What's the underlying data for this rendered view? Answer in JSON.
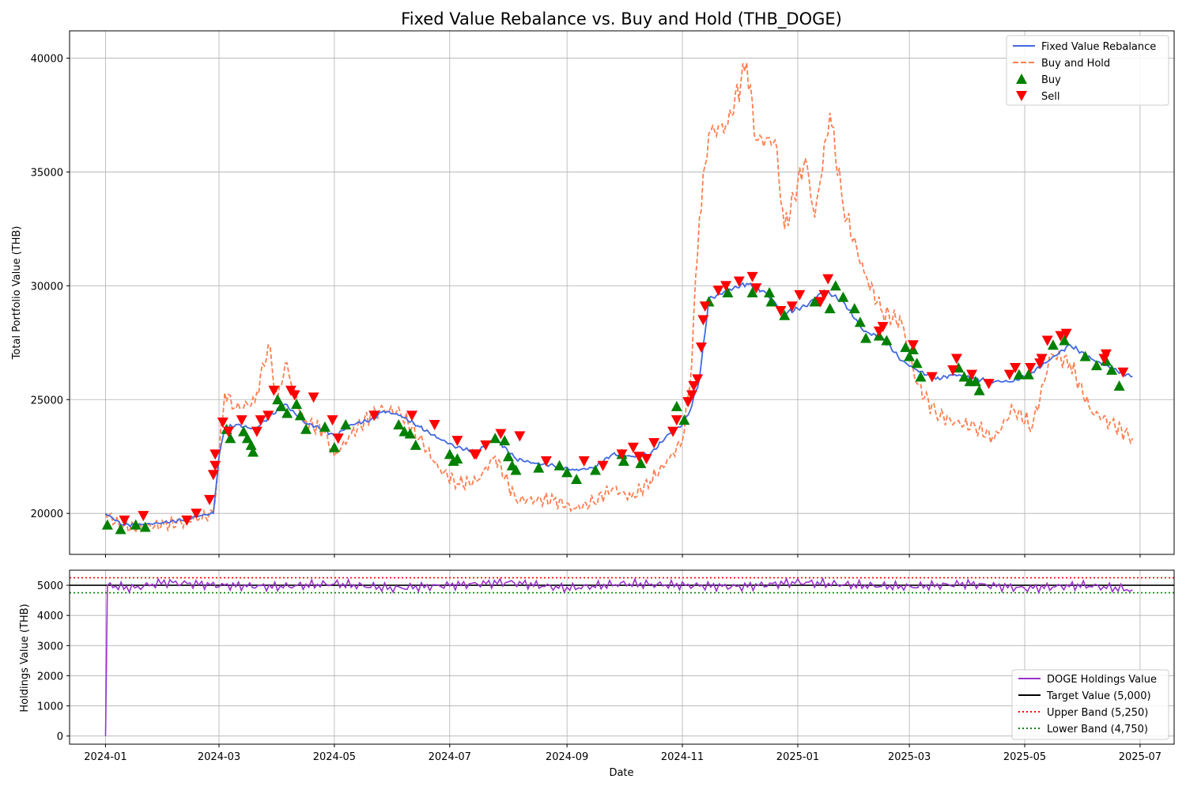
{
  "chart_data": [
    {
      "type": "line",
      "title": "Fixed Value Rebalance vs. Buy and Hold (THB_DOGE)",
      "xlabel": "",
      "ylabel": "Total Portfolio Value (THB)",
      "xlim": [
        "2023-12-13",
        "2025-07-19"
      ],
      "ylim": [
        18200,
        41200
      ],
      "x_ticks": [
        "2024-01-01",
        "2024-03-01",
        "2024-05-01",
        "2024-07-01",
        "2024-09-01",
        "2024-11-01",
        "2025-01-01",
        "2025-03-01",
        "2025-05-01",
        "2025-07-01"
      ],
      "x_tick_labels": [
        "2024-01",
        "2024-03",
        "2024-05",
        "2024-07",
        "2024-09",
        "2024-11",
        "2025-01",
        "2025-03",
        "2025-05",
        "2025-07"
      ],
      "y_ticks": [
        20000,
        25000,
        30000,
        35000,
        40000
      ],
      "grid": true,
      "legend_position": "top-right",
      "colors": {
        "rebalance": "#4169e1",
        "buy_hold": "#ff7f50",
        "buy": "#008000",
        "sell": "#ff0000"
      },
      "series": [
        {
          "name": "Fixed Value Rebalance",
          "style": "solid",
          "x": [
            "2024-01-01",
            "2024-01-10",
            "2024-01-20",
            "2024-02-01",
            "2024-02-10",
            "2024-02-20",
            "2024-02-27",
            "2024-03-01",
            "2024-03-04",
            "2024-03-10",
            "2024-03-20",
            "2024-03-27",
            "2024-04-05",
            "2024-04-15",
            "2024-04-25",
            "2024-05-01",
            "2024-05-10",
            "2024-05-20",
            "2024-05-27",
            "2024-06-05",
            "2024-06-15",
            "2024-06-25",
            "2024-07-05",
            "2024-07-15",
            "2024-07-25",
            "2024-08-05",
            "2024-08-15",
            "2024-08-25",
            "2024-09-05",
            "2024-09-15",
            "2024-09-25",
            "2024-10-05",
            "2024-10-15",
            "2024-10-25",
            "2024-11-01",
            "2024-11-05",
            "2024-11-10",
            "2024-11-15",
            "2024-11-25",
            "2024-12-05",
            "2024-12-15",
            "2024-12-25",
            "2025-01-05",
            "2025-01-15",
            "2025-01-25",
            "2025-02-05",
            "2025-02-15",
            "2025-02-25",
            "2025-03-05",
            "2025-03-15",
            "2025-03-25",
            "2025-04-05",
            "2025-04-15",
            "2025-04-25",
            "2025-05-05",
            "2025-05-15",
            "2025-05-25",
            "2025-06-05",
            "2025-06-15",
            "2025-06-27"
          ],
          "values": [
            20000,
            19500,
            19500,
            19600,
            19700,
            19900,
            20000,
            22500,
            23700,
            23900,
            23700,
            24200,
            24800,
            24000,
            23700,
            23400,
            23900,
            24100,
            24500,
            24300,
            23800,
            23300,
            22900,
            22700,
            23300,
            22400,
            22200,
            22100,
            21900,
            22000,
            22600,
            22500,
            22600,
            23500,
            23900,
            24500,
            25900,
            29400,
            29800,
            30100,
            29700,
            28800,
            29100,
            29800,
            29300,
            28000,
            27700,
            26700,
            26300,
            25900,
            26100,
            25900,
            25800,
            25800,
            26200,
            26800,
            27400,
            26800,
            26400,
            26000
          ]
        },
        {
          "name": "Buy and Hold",
          "style": "dashed",
          "x": [
            "2024-01-01",
            "2024-01-10",
            "2024-01-20",
            "2024-02-01",
            "2024-02-10",
            "2024-02-20",
            "2024-02-27",
            "2024-03-01",
            "2024-03-04",
            "2024-03-10",
            "2024-03-20",
            "2024-03-27",
            "2024-04-01",
            "2024-04-05",
            "2024-04-15",
            "2024-04-25",
            "2024-05-01",
            "2024-05-10",
            "2024-05-20",
            "2024-05-27",
            "2024-06-05",
            "2024-06-15",
            "2024-06-25",
            "2024-07-05",
            "2024-07-15",
            "2024-07-25",
            "2024-08-05",
            "2024-08-15",
            "2024-08-25",
            "2024-09-05",
            "2024-09-15",
            "2024-09-25",
            "2024-10-05",
            "2024-10-15",
            "2024-10-25",
            "2024-11-01",
            "2024-11-05",
            "2024-11-10",
            "2024-11-15",
            "2024-11-25",
            "2024-12-05",
            "2024-12-10",
            "2024-12-20",
            "2024-12-25",
            "2025-01-05",
            "2025-01-10",
            "2025-01-18",
            "2025-01-25",
            "2025-02-05",
            "2025-02-15",
            "2025-02-25",
            "2025-03-05",
            "2025-03-15",
            "2025-03-25",
            "2025-04-05",
            "2025-04-15",
            "2025-04-25",
            "2025-05-05",
            "2025-05-15",
            "2025-05-25",
            "2025-06-05",
            "2025-06-15",
            "2025-06-27"
          ],
          "values": [
            20000,
            19400,
            19400,
            19500,
            19600,
            19800,
            20000,
            22500,
            25300,
            24600,
            24900,
            27400,
            25000,
            26600,
            24000,
            23700,
            22500,
            23500,
            24300,
            24600,
            24400,
            23300,
            22000,
            21300,
            21400,
            22500,
            20600,
            20600,
            20600,
            20200,
            20500,
            21100,
            20700,
            21400,
            22400,
            23200,
            25600,
            33000,
            36700,
            37100,
            39800,
            36400,
            36400,
            32500,
            35600,
            33000,
            37600,
            33500,
            30600,
            28800,
            28400,
            25700,
            24400,
            24000,
            23800,
            23300,
            24600,
            23800,
            27000,
            26600,
            24500,
            24000,
            23300
          ]
        }
      ],
      "markers": {
        "buy": {
          "name": "Buy",
          "x": [
            "2024-01-02",
            "2024-01-09",
            "2024-01-17",
            "2024-01-22",
            "2024-03-05",
            "2024-03-07",
            "2024-03-14",
            "2024-03-16",
            "2024-03-18",
            "2024-03-19",
            "2024-04-01",
            "2024-04-03",
            "2024-04-06",
            "2024-04-11",
            "2024-04-13",
            "2024-04-16",
            "2024-04-26",
            "2024-05-01",
            "2024-05-07",
            "2024-06-04",
            "2024-06-07",
            "2024-06-10",
            "2024-06-13",
            "2024-07-01",
            "2024-07-03",
            "2024-07-05",
            "2024-07-25",
            "2024-07-30",
            "2024-08-01",
            "2024-08-03",
            "2024-08-05",
            "2024-08-17",
            "2024-08-28",
            "2024-09-01",
            "2024-09-06",
            "2024-09-16",
            "2024-09-30",
            "2024-10-01",
            "2024-10-10",
            "2024-10-29",
            "2024-11-02",
            "2024-11-15",
            "2024-11-25",
            "2024-12-08",
            "2024-12-17",
            "2024-12-18",
            "2024-12-25",
            "2025-01-10",
            "2025-01-18",
            "2025-01-21",
            "2025-01-25",
            "2025-01-31",
            "2025-02-03",
            "2025-02-06",
            "2025-02-13",
            "2025-02-17",
            "2025-02-27",
            "2025-03-01",
            "2025-03-03",
            "2025-03-05",
            "2025-03-07",
            "2025-03-27",
            "2025-03-30",
            "2025-04-02",
            "2025-04-05",
            "2025-04-07",
            "2025-04-28",
            "2025-05-03",
            "2025-05-16",
            "2025-05-22",
            "2025-06-02",
            "2025-06-08",
            "2025-06-13",
            "2025-06-16",
            "2025-06-20"
          ],
          "values": [
            19500,
            19300,
            19500,
            19400,
            23700,
            23300,
            23600,
            23300,
            23000,
            22700,
            25000,
            24700,
            24400,
            24800,
            24300,
            23700,
            23800,
            22900,
            23900,
            23900,
            23600,
            23500,
            23000,
            22600,
            22300,
            22400,
            23300,
            23200,
            22500,
            22100,
            21900,
            22000,
            22100,
            21800,
            21500,
            21900,
            22600,
            22300,
            22200,
            24700,
            24100,
            29300,
            29700,
            29700,
            29700,
            29300,
            28700,
            29300,
            29000,
            30000,
            29500,
            29000,
            28400,
            27700,
            27800,
            27600,
            27300,
            26900,
            27200,
            26600,
            26000,
            26400,
            26000,
            25800,
            25800,
            25400,
            26100,
            26100,
            27400,
            27600,
            26900,
            26500,
            26700,
            26300,
            25600
          ],
          "direction": "up"
        },
        "sell": {
          "name": "Sell",
          "x": [
            "2024-01-11",
            "2024-01-21",
            "2024-02-13",
            "2024-02-18",
            "2024-02-25",
            "2024-02-27",
            "2024-02-28",
            "2024-02-28",
            "2024-03-03",
            "2024-03-06",
            "2024-03-13",
            "2024-03-21",
            "2024-03-23",
            "2024-03-27",
            "2024-03-30",
            "2024-04-08",
            "2024-04-10",
            "2024-04-20",
            "2024-04-30",
            "2024-05-03",
            "2024-05-22",
            "2024-06-11",
            "2024-06-23",
            "2024-07-05",
            "2024-07-14",
            "2024-07-15",
            "2024-07-20",
            "2024-07-28",
            "2024-08-07",
            "2024-08-21",
            "2024-09-10",
            "2024-09-20",
            "2024-09-30",
            "2024-10-06",
            "2024-10-09",
            "2024-10-13",
            "2024-10-17",
            "2024-10-27",
            "2024-10-29",
            "2024-11-04",
            "2024-11-06",
            "2024-11-07",
            "2024-11-09",
            "2024-11-11",
            "2024-11-12",
            "2024-11-13",
            "2024-11-20",
            "2024-11-24",
            "2024-12-01",
            "2024-12-08",
            "2024-12-10",
            "2024-12-23",
            "2024-12-29",
            "2025-01-02",
            "2025-01-13",
            "2025-01-15",
            "2025-01-17",
            "2025-02-13",
            "2025-02-15",
            "2025-03-03",
            "2025-03-13",
            "2025-03-24",
            "2025-03-26",
            "2025-04-03",
            "2025-04-12",
            "2025-04-23",
            "2025-04-26",
            "2025-05-04",
            "2025-05-09",
            "2025-05-10",
            "2025-05-13",
            "2025-05-20",
            "2025-05-23",
            "2025-06-12",
            "2025-06-13",
            "2025-06-22"
          ],
          "values": [
            19700,
            19900,
            19700,
            20000,
            20600,
            21700,
            22100,
            22600,
            24000,
            23600,
            24100,
            23600,
            24100,
            24300,
            25400,
            25400,
            25200,
            25100,
            24100,
            23300,
            24300,
            24300,
            23900,
            23200,
            22600,
            22600,
            23000,
            23500,
            23400,
            22300,
            22300,
            22100,
            22600,
            22900,
            22500,
            22400,
            23100,
            23600,
            24100,
            24900,
            25200,
            25600,
            25900,
            27300,
            28500,
            29100,
            29800,
            30000,
            30200,
            30400,
            29900,
            28900,
            29100,
            29600,
            29300,
            29600,
            30300,
            28000,
            28200,
            27400,
            26000,
            26300,
            26800,
            26100,
            25700,
            26100,
            26400,
            26400,
            26600,
            26800,
            27600,
            27800,
            27900,
            26800,
            27000,
            26200
          ]
        }
      }
    },
    {
      "type": "line",
      "title": "",
      "xlabel": "Date",
      "ylabel": "Holdings Value (THB)",
      "xlim": [
        "2023-12-13",
        "2025-07-19"
      ],
      "ylim": [
        -270,
        5500
      ],
      "y_ticks": [
        0,
        1000,
        2000,
        3000,
        4000,
        5000
      ],
      "grid": true,
      "legend_position": "bottom-right",
      "colors": {
        "holdings": "#9932cc",
        "target": "#000000",
        "upper": "#ff0000",
        "lower": "#008000"
      },
      "series": [
        {
          "name": "DOGE Holdings Value",
          "x": [
            "2024-01-01",
            "2024-01-02",
            "2024-01-15",
            "2024-02-01",
            "2024-03-01",
            "2024-04-01",
            "2024-05-01",
            "2024-06-01",
            "2024-07-01",
            "2024-08-01",
            "2024-09-01",
            "2024-10-01",
            "2024-11-01",
            "2024-12-01",
            "2025-01-01",
            "2025-02-01",
            "2025-03-01",
            "2025-04-01",
            "2025-05-01",
            "2025-06-01",
            "2025-06-27"
          ],
          "values": [
            0,
            5000,
            4900,
            5100,
            5000,
            4950,
            5050,
            4900,
            5000,
            5100,
            4900,
            5050,
            5000,
            4950,
            5100,
            5000,
            4950,
            5050,
            4900,
            5000,
            4850
          ],
          "oscillation": 170
        },
        {
          "name": "Target Value (5,000)",
          "style": "solid",
          "y": 5000
        },
        {
          "name": "Upper Band (5,250)",
          "style": "dotted",
          "y": 5250
        },
        {
          "name": "Lower Band (4,750)",
          "style": "dotted",
          "y": 4750
        }
      ]
    }
  ]
}
